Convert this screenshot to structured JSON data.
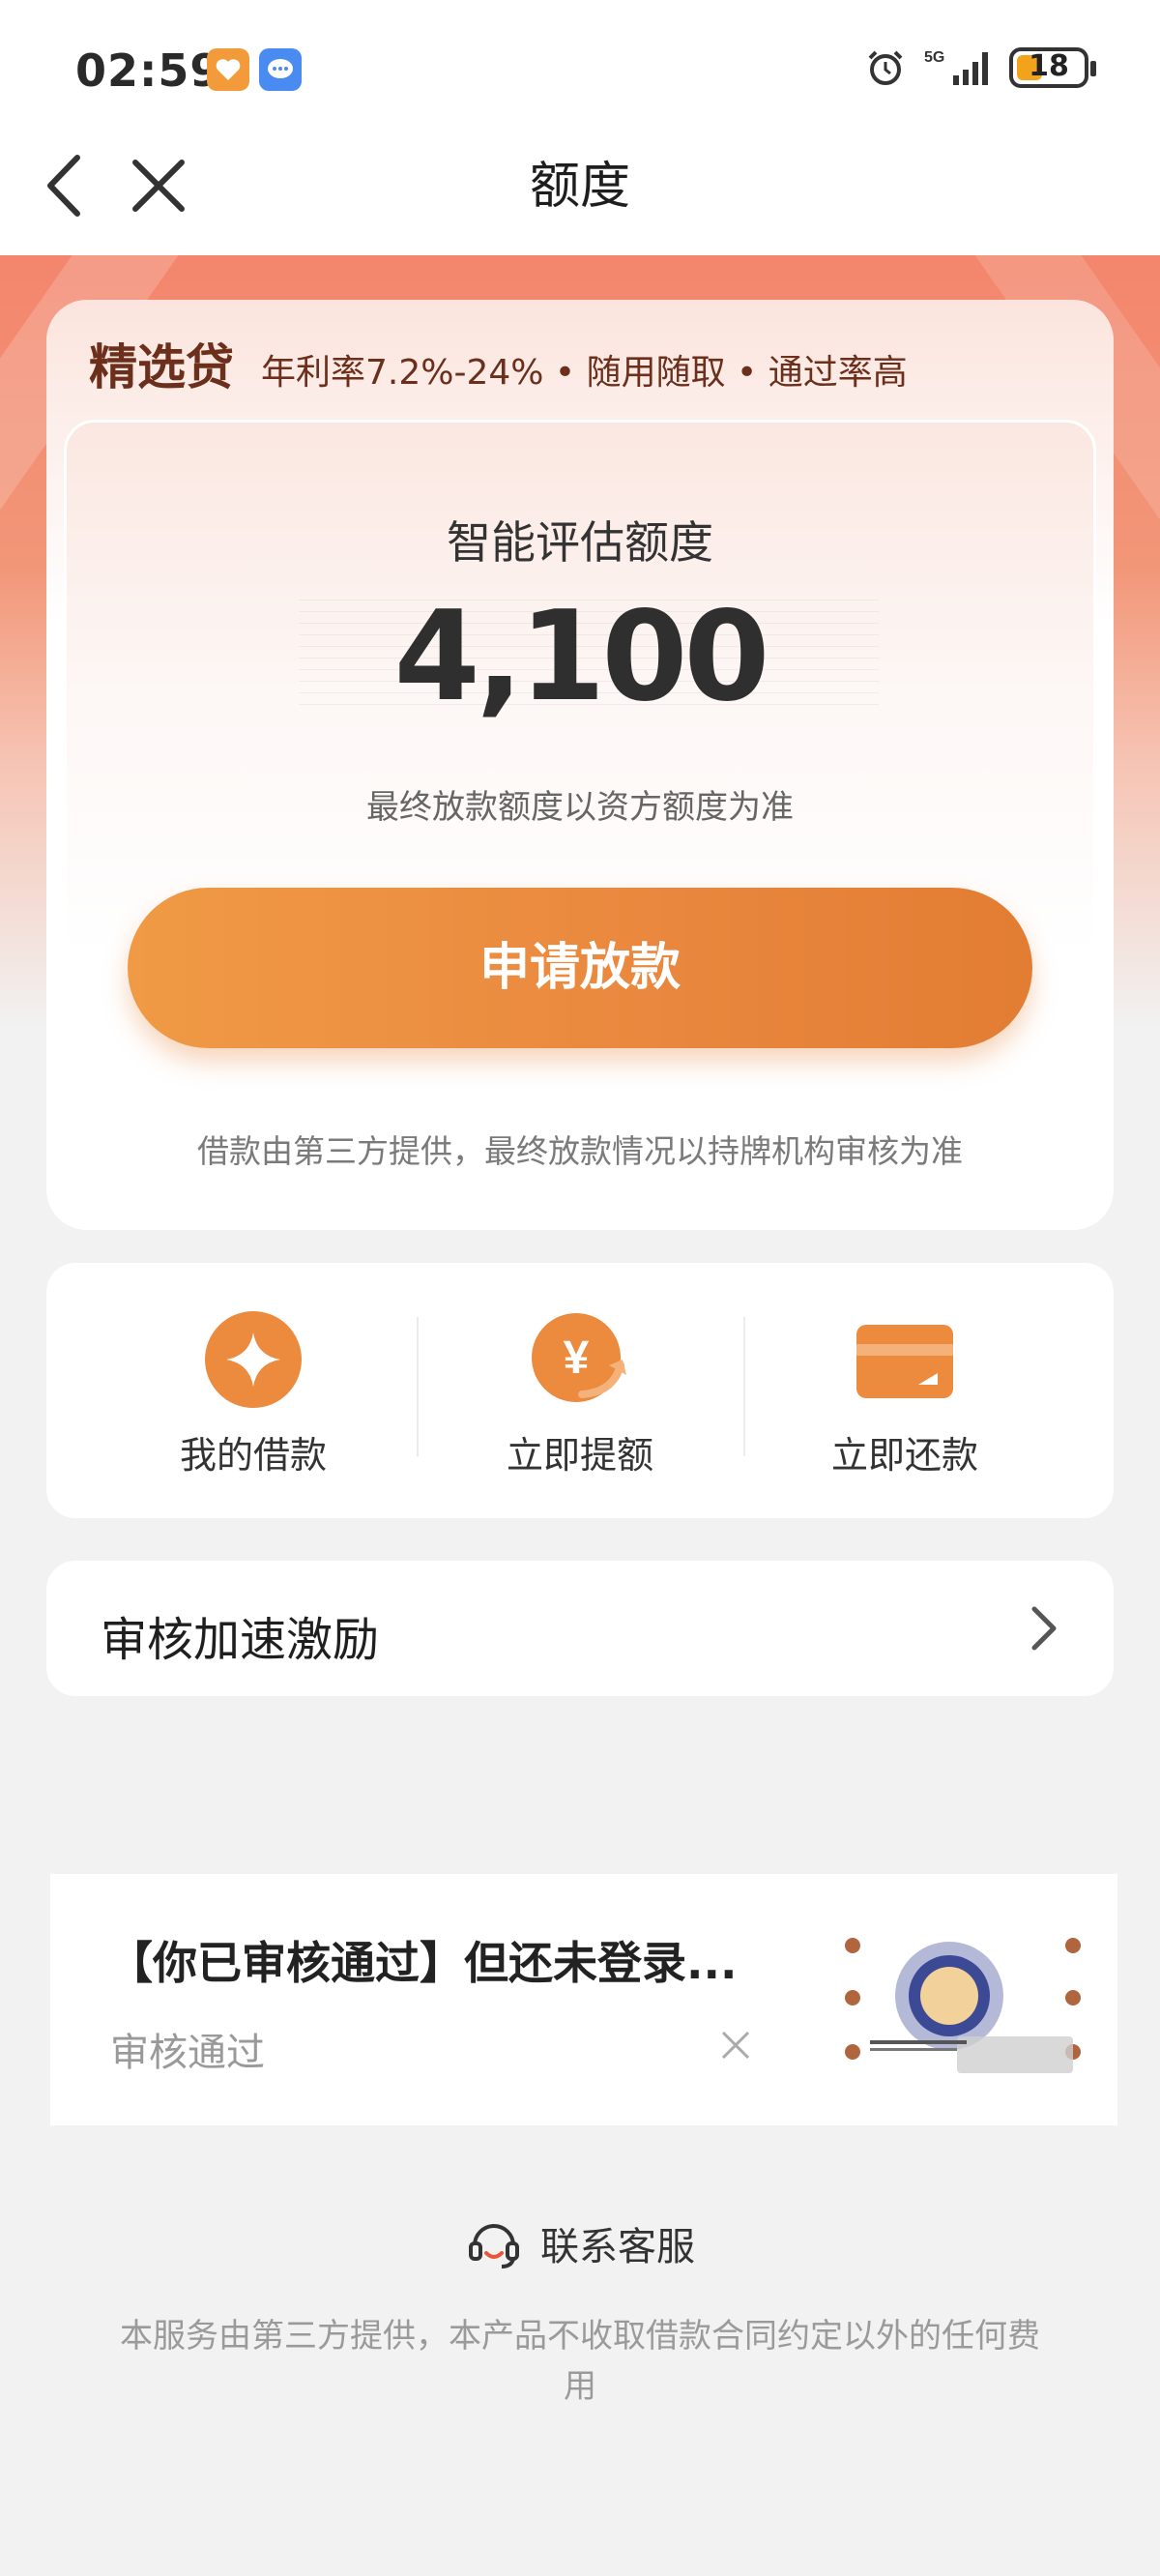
{
  "status_bar": {
    "time": "02:59",
    "network": "5G",
    "battery": "18"
  },
  "nav": {
    "title": "额度"
  },
  "loan_card": {
    "brand": "精选贷",
    "tagline": "年利率7.2%-24% • 随用随取 • 通过率高",
    "quota_label": "智能评估额度",
    "quota_value": "4,100",
    "quota_note": "最终放款额度以资方额度为准",
    "apply_button": "申请放款",
    "disclaimer": "借款由第三方提供，最终放款情况以持牌机构审核为准"
  },
  "shortcuts": [
    {
      "label": "我的借款",
      "icon": "diamond-icon"
    },
    {
      "label": "立即提额",
      "icon": "yuan-up-icon"
    },
    {
      "label": "立即还款",
      "icon": "card-icon"
    }
  ],
  "incentive": {
    "label": "审核加速激励"
  },
  "ad": {
    "title": "【你已审核通过】但还未登录...",
    "subtitle": "审核通过"
  },
  "footer": {
    "customer_service": "联系客服",
    "note": "本服务由第三方提供，本产品不收取借款合同约定以外的任何费用"
  },
  "colors": {
    "accent": "#e98a3e",
    "brand_text": "#6b2f1c",
    "hero": "#f3866d"
  }
}
